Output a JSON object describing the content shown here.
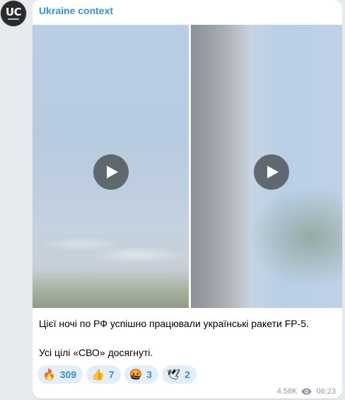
{
  "channel": {
    "name": "Ukraine context",
    "avatar_text": "UC"
  },
  "post": {
    "media": [
      {
        "kind": "video",
        "icon": "play-icon"
      },
      {
        "kind": "video",
        "icon": "play-icon"
      }
    ],
    "text_lines": [
      "Цієї ночі по РФ успішно працювали українські ракети FP-5.",
      "Усі цілі «СВО» досягнуті."
    ],
    "reactions": [
      {
        "emoji": "🔥",
        "count": "309"
      },
      {
        "emoji": "👍",
        "count": "7"
      },
      {
        "emoji": "🤬",
        "count": "3"
      },
      {
        "emoji": "🕊",
        "count": "2"
      }
    ],
    "views": "4.58K",
    "time": "06:23"
  },
  "colors": {
    "accent": "#3a8fd0",
    "background": "#e7ebf0",
    "bubble": "#ffffff",
    "reaction_bg": "#e4eef8",
    "meta": "#8f98a0"
  }
}
